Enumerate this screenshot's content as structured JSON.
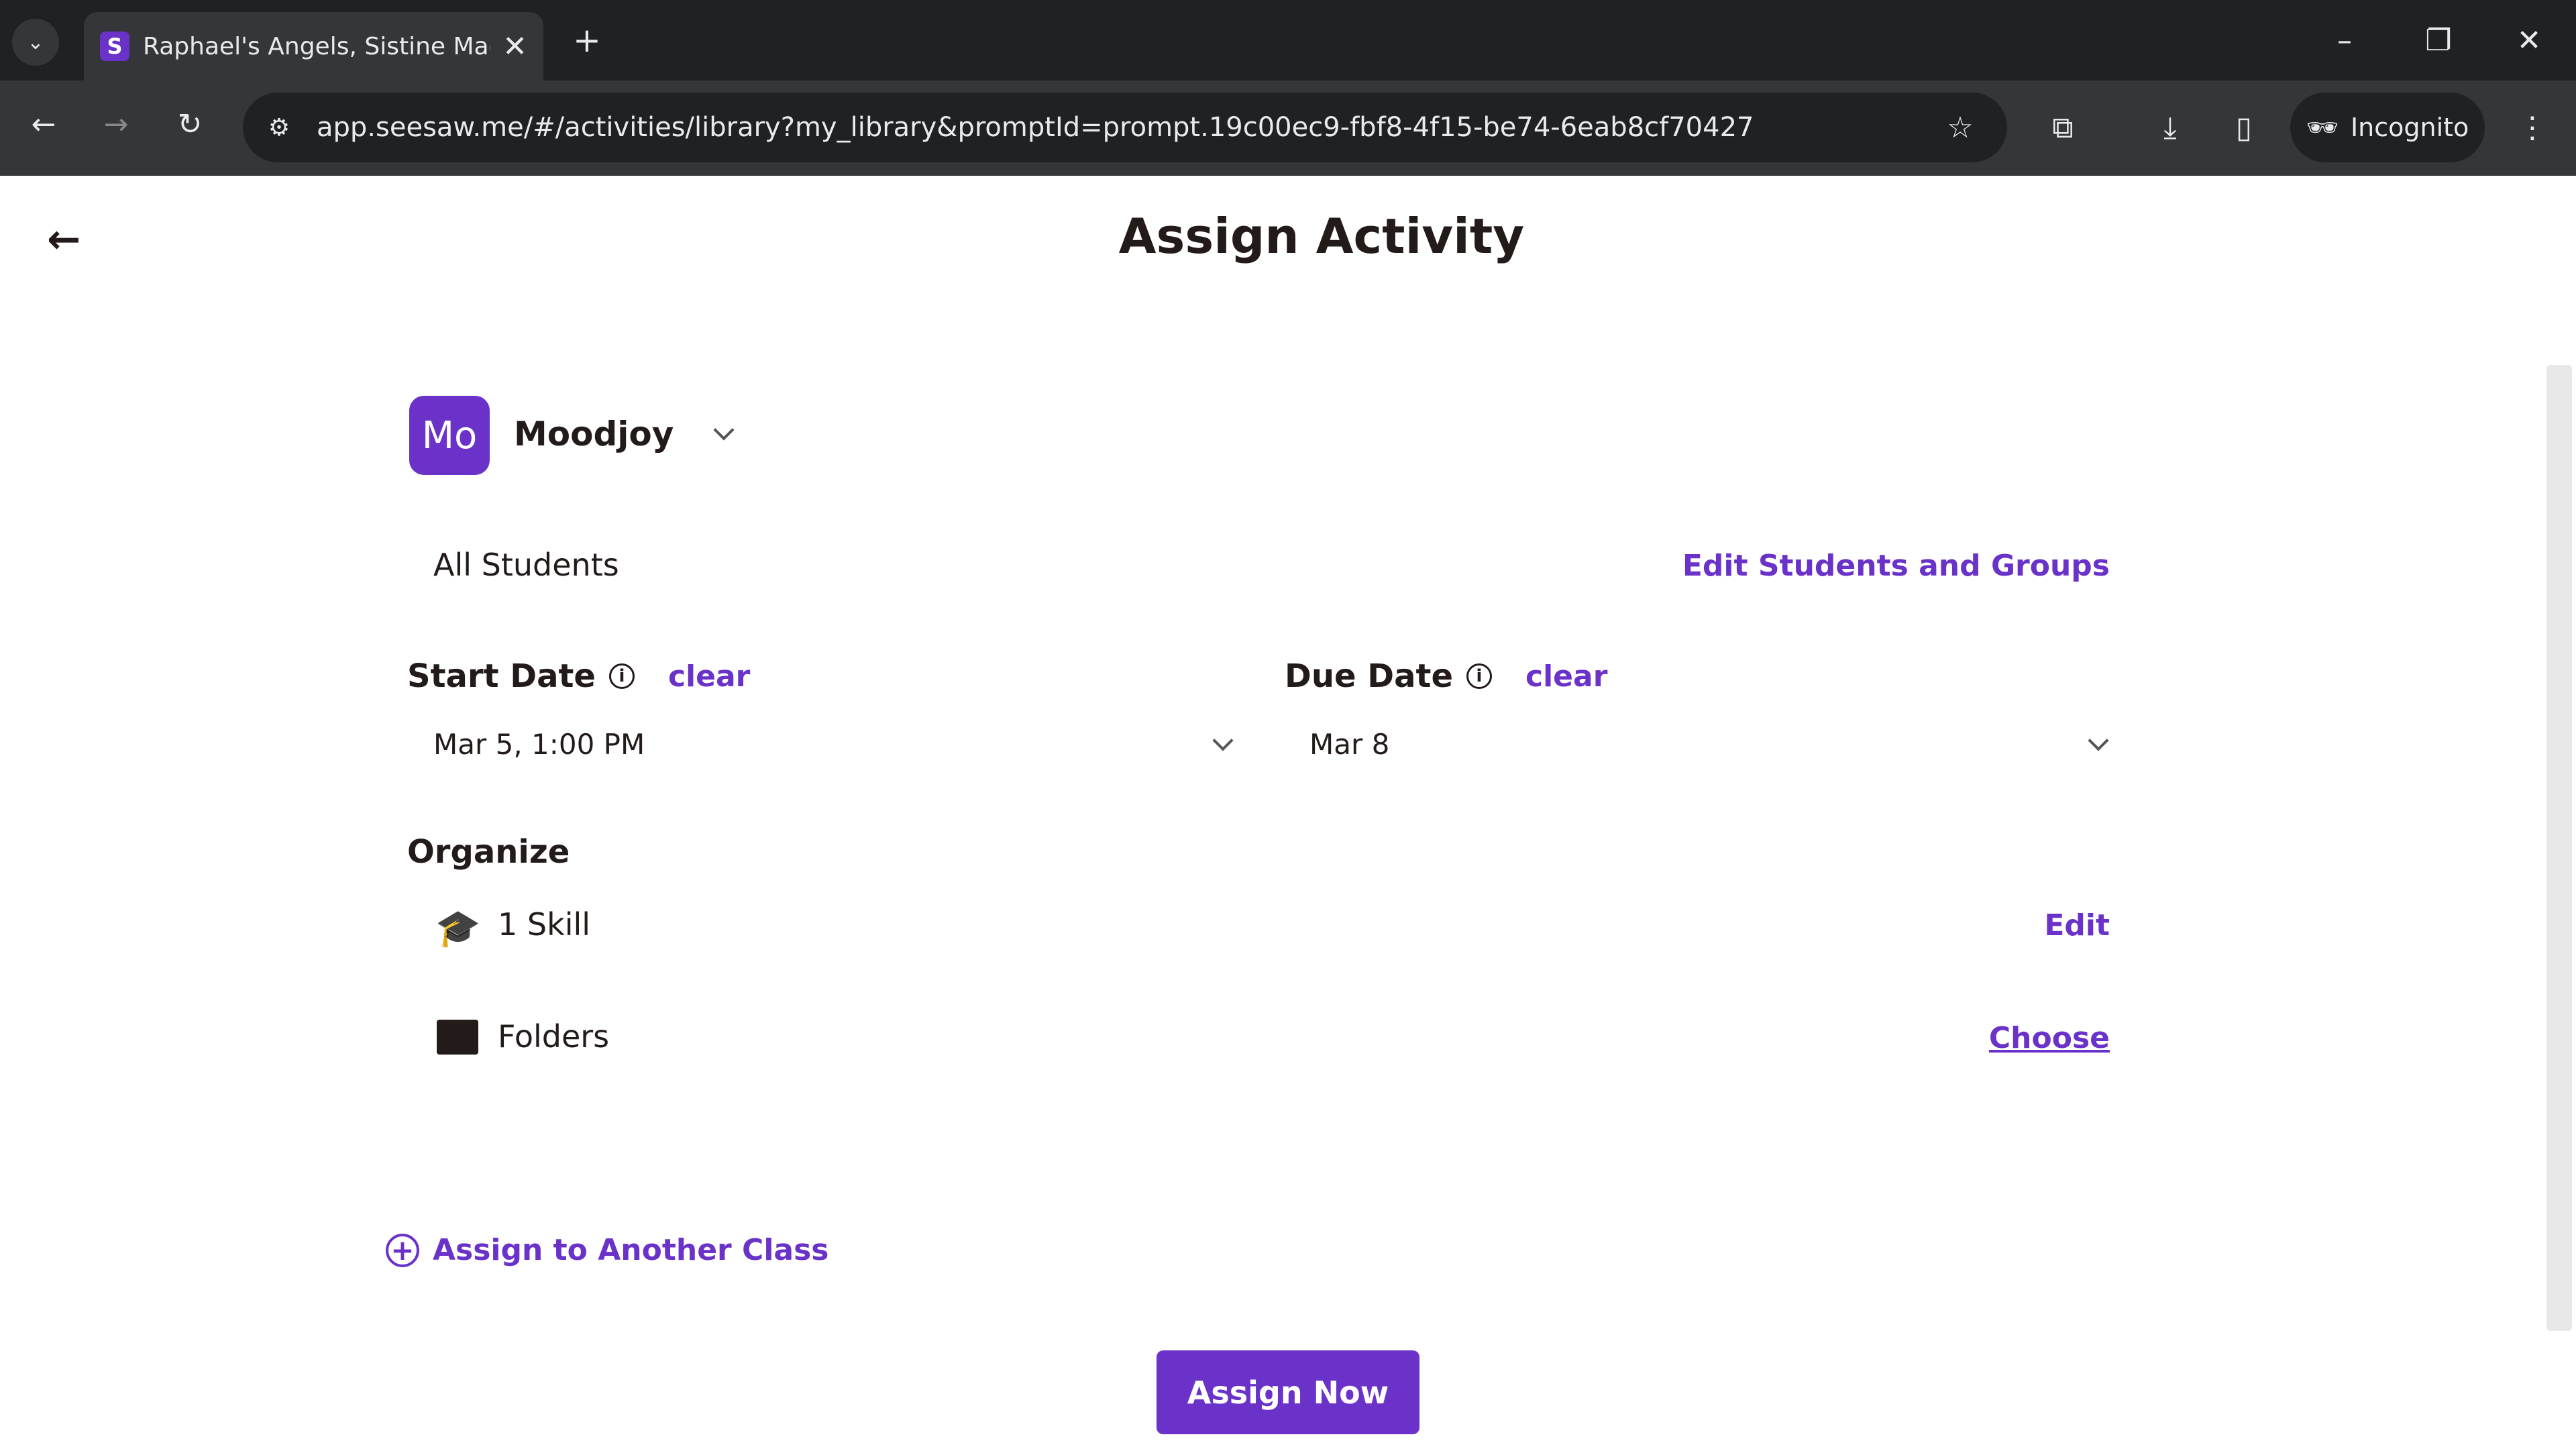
{
  "browser": {
    "tab_title": "Raphael's Angels, Sistine Madonna",
    "url": "app.seesaw.me/#/activities/library?my_library&promptId=prompt.19c00ec9-fbf8-4f15-be74-6eab8cf70427",
    "incognito_label": "Incognito",
    "favicon_letter": "S"
  },
  "page": {
    "title": "Assign Activity"
  },
  "class": {
    "avatar": "Mo",
    "name": "Moodjoy"
  },
  "students": {
    "label": "All Students",
    "edit_link": "Edit Students and Groups"
  },
  "start_date": {
    "label": "Start Date",
    "clear": "clear",
    "value": "Mar 5, 1:00 PM"
  },
  "due_date": {
    "label": "Due Date",
    "clear": "clear",
    "value": "Mar 8"
  },
  "organize": {
    "label": "Organize",
    "skill_label": "1 Skill",
    "skill_action": "Edit",
    "folders_label": "Folders",
    "folders_action": "Choose"
  },
  "assign_another": "Assign to Another Class",
  "assign_now": "Assign Now",
  "colors": {
    "accent": "#6a32c9",
    "text": "#231a1a"
  }
}
